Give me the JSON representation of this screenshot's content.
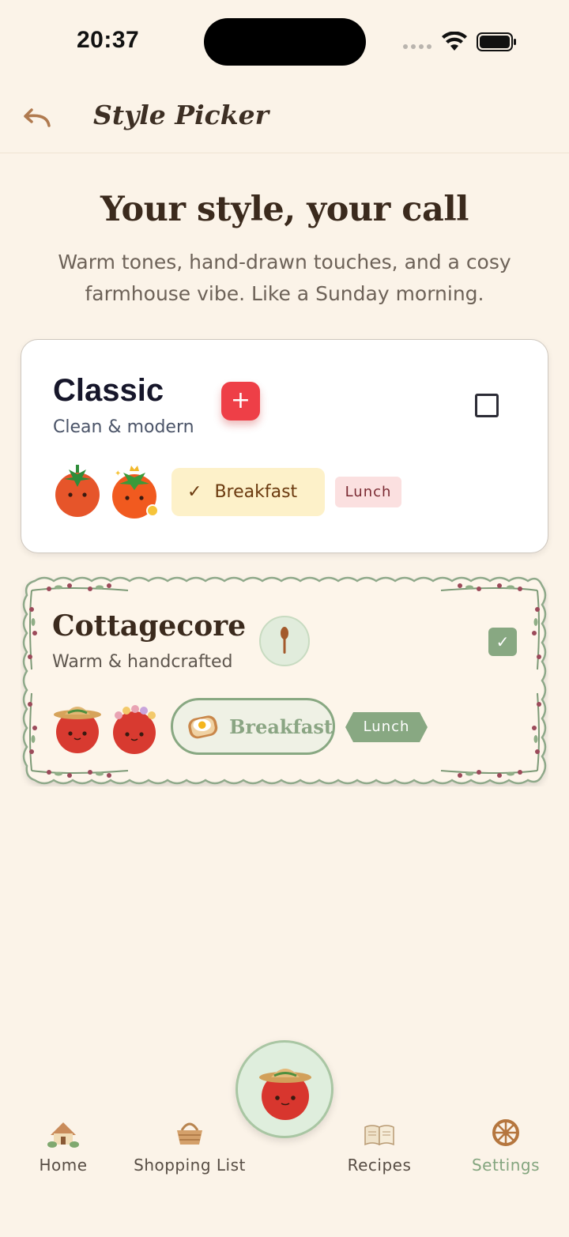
{
  "status_bar": {
    "time": "20:37"
  },
  "header": {
    "title": "Style Picker"
  },
  "hero": {
    "title": "Your style, your call",
    "subtitle": "Warm tones, hand-drawn touches, and a cosy farmhouse vibe. Like a Sunday morning."
  },
  "styles": {
    "classic": {
      "name": "Classic",
      "description": "Clean & modern",
      "selected": false,
      "chip_primary": "Breakfast",
      "chip_secondary": "Lunch",
      "check_glyph": "✓",
      "add_glyph": "+"
    },
    "cottagecore": {
      "name": "Cottagecore",
      "description": "Warm & handcrafted",
      "selected": true,
      "chip_primary": "Breakfast",
      "chip_secondary": "Lunch",
      "check_glyph": "✓"
    }
  },
  "nav": {
    "items": [
      {
        "label": "Home",
        "icon": "cottage-icon",
        "active": false
      },
      {
        "label": "Shopping List",
        "icon": "basket-icon",
        "active": false
      },
      {
        "label": "Recipes",
        "icon": "book-icon",
        "active": false
      },
      {
        "label": "Settings",
        "icon": "wheel-icon",
        "active": true
      }
    ],
    "center_icon": "tomato-straw-hat-icon"
  },
  "colors": {
    "background": "#fbf3e8",
    "classic_accent": "#ee3f47",
    "cottage_accent": "#88a882",
    "text_dark": "#3b2a1d"
  }
}
